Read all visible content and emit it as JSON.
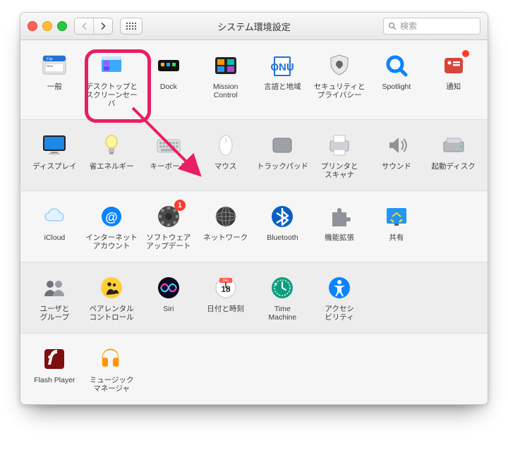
{
  "window": {
    "title": "システム環境設定"
  },
  "search": {
    "placeholder": "検索"
  },
  "rows": [
    {
      "alt": false,
      "items": [
        {
          "id": "general",
          "label": "一般"
        },
        {
          "id": "desktop",
          "label": "デスクトップと\nスクリーンセーバ",
          "highlight": true
        },
        {
          "id": "dock",
          "label": "Dock"
        },
        {
          "id": "mission",
          "label": "Mission\nControl"
        },
        {
          "id": "language",
          "label": "言語と地域"
        },
        {
          "id": "security",
          "label": "セキュリティと\nプライバシー"
        },
        {
          "id": "spotlight",
          "label": "Spotlight"
        },
        {
          "id": "notifications",
          "label": "通知",
          "badge": true
        }
      ]
    },
    {
      "alt": true,
      "items": [
        {
          "id": "displays",
          "label": "ディスプレイ"
        },
        {
          "id": "energy",
          "label": "省エネルギー"
        },
        {
          "id": "keyboard",
          "label": "キーボード"
        },
        {
          "id": "mouse",
          "label": "マウス"
        },
        {
          "id": "trackpad",
          "label": "トラックパッド"
        },
        {
          "id": "printers",
          "label": "プリンタと\nスキャナ"
        },
        {
          "id": "sound",
          "label": "サウンド"
        },
        {
          "id": "startup",
          "label": "起動ディスク"
        }
      ]
    },
    {
      "alt": false,
      "items": [
        {
          "id": "icloud",
          "label": "iCloud"
        },
        {
          "id": "internet",
          "label": "インターネット\nアカウント"
        },
        {
          "id": "software",
          "label": "ソフトウェア\nアップデート",
          "badge_text": "1"
        },
        {
          "id": "network",
          "label": "ネットワーク"
        },
        {
          "id": "bluetooth",
          "label": "Bluetooth"
        },
        {
          "id": "extensions",
          "label": "機能拡張"
        },
        {
          "id": "sharing",
          "label": "共有"
        }
      ]
    },
    {
      "alt": true,
      "items": [
        {
          "id": "users",
          "label": "ユーザと\nグループ"
        },
        {
          "id": "parental",
          "label": "ペアレンタル\nコントロール"
        },
        {
          "id": "siri",
          "label": "Siri"
        },
        {
          "id": "datetime",
          "label": "日付と時刻"
        },
        {
          "id": "timemachine",
          "label": "Time\nMachine"
        },
        {
          "id": "accessibility",
          "label": "アクセシ\nビリティ"
        }
      ]
    },
    {
      "alt": false,
      "items": [
        {
          "id": "flash",
          "label": "Flash Player"
        },
        {
          "id": "music",
          "label": "ミュージック\nマネージャ"
        }
      ]
    }
  ]
}
